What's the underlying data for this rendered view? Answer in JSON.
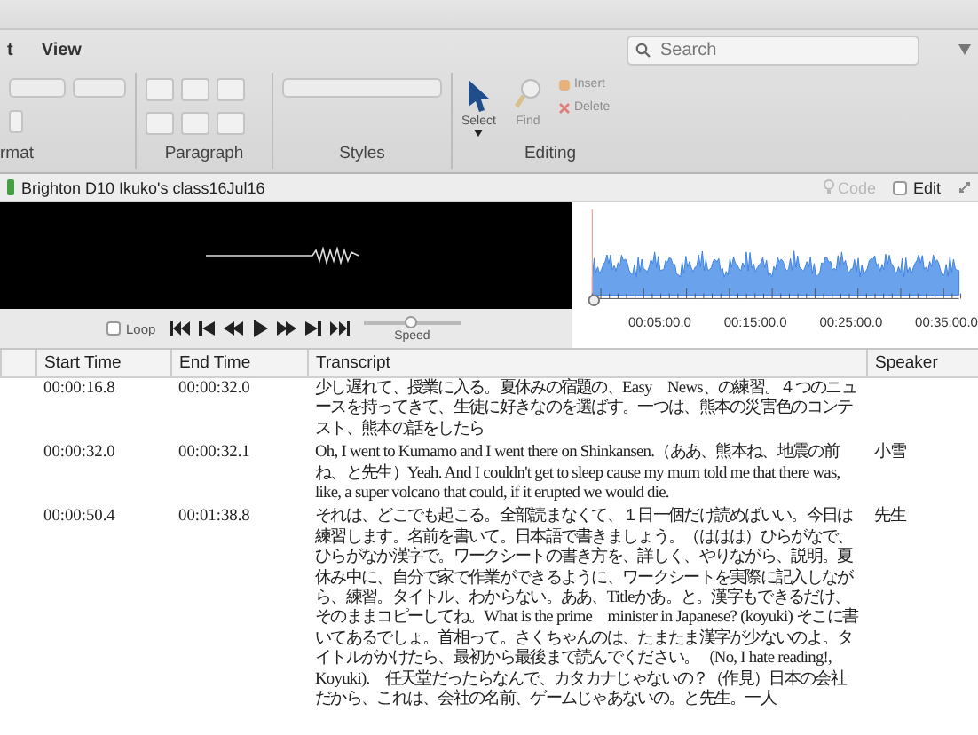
{
  "ribbon": {
    "tabs": [
      {
        "label": "t",
        "selected": false
      },
      {
        "label": "View",
        "selected": false
      }
    ],
    "groups": [
      "rmat",
      "Paragraph",
      "Styles",
      "Editing"
    ],
    "select_label": "Select",
    "find_label": "Find",
    "insert_label": "Insert",
    "delete_label": "Delete",
    "search": {
      "placeholder": "Search"
    }
  },
  "document": {
    "title": "Brighton D10 Ikuko's class16Jul16",
    "code_label": "Code",
    "edit": {
      "label": "Edit",
      "checked": false
    }
  },
  "player": {
    "loop": {
      "label": "Loop",
      "checked": false
    },
    "speed_label": "Speed",
    "speed": {
      "level": 0.5
    },
    "timeline_labels": [
      "00:05:00.0",
      "00:15:00.0",
      "00:25:00.0",
      "00:35:00.0"
    ]
  },
  "table": {
    "columns": [
      "Start Time",
      "End Time",
      "Transcript",
      "Speaker"
    ],
    "rows": [
      {
        "start": "00:00:16.8",
        "end": "00:00:32.0",
        "transcript": "少し遅れて、授業に入る。夏休みの宿題の、Easy　News、の練習。４つのニュースを持ってきて、生徒に好きなのを選ばす。一つは、熊本の災害色のコンテスト、熊本の話をしたら",
        "speaker": ""
      },
      {
        "start": "00:00:32.0",
        "end": "00:00:32.1",
        "transcript": "Oh, I went to Kumamo and I went there on Shinkansen.（ああ、熊本ね、地震の前ね、と先生）Yeah. And I couldn't get to sleep cause my mum told me that there was, like, a super volcano that could, if it erupted we would die.",
        "speaker": "小雪"
      },
      {
        "start": "00:00:50.4",
        "end": "00:01:38.8",
        "transcript": "それは、どこでも起こる。全部読まなくて、１日一個だけ読めばいい。今日は練習します。名前を書いて。日本語で書きましょう。（ははは）ひらがなで、ひらがなか漢字で。ワークシートの書き方を、詳しく、やりながら、説明。夏休み中に、自分で家で作業ができるように、ワークシートを実際に記入しながら、練習。タイトル、わからない。ああ、Titleかあ。と。漢字もできるだけ、そのままコピーしてね。What is the prime　minister in Japanese? (koyuki) そこに書いてあるでしょ。首相って。さくちゃんのは、たまたま漢字が少ないのよ。タイトルがかけたら、最初から最後まで読んでください。（No, I hate reading!, Koyuki).　任天堂だったらなんで、カタカナじゃないの？（作見）日本の会社だから、これは、会社の名前、ゲームじゃあないの。と先生。一人",
        "speaker": "先生"
      }
    ]
  }
}
